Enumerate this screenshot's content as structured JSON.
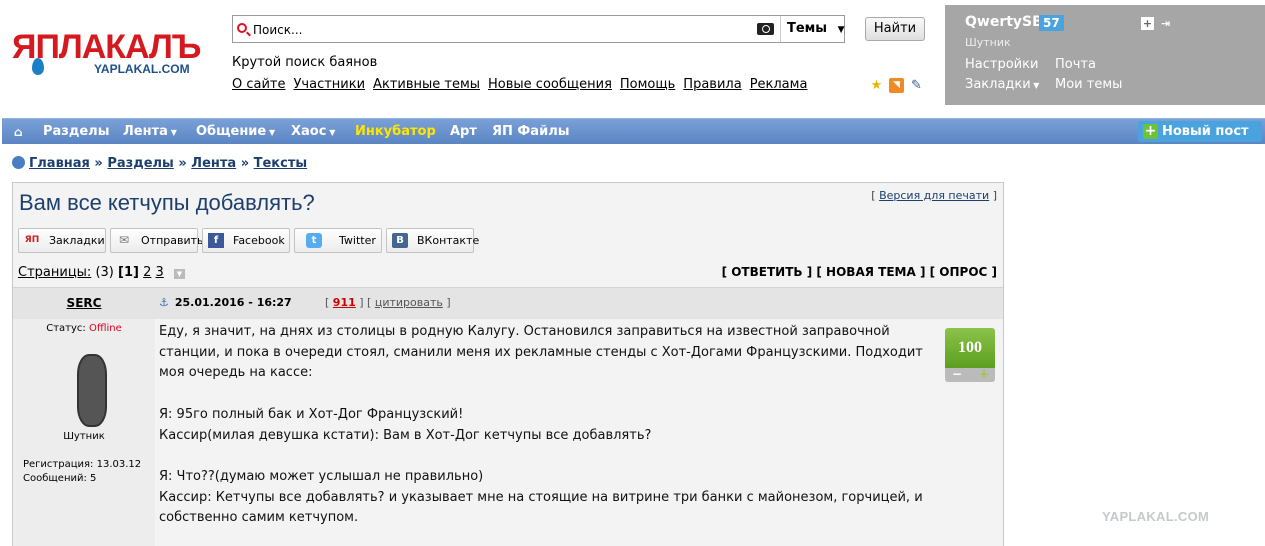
{
  "logo": {
    "main": "ЯПЛАКАЛЪ",
    "sub": "YAPLAKAL.COM"
  },
  "search": {
    "placeholder": "Поиск...",
    "scope": "Темы",
    "button": "Найти"
  },
  "tagline": "Крутой поиск баянов",
  "top_links": [
    "О сайте",
    "Участники",
    "Активные темы",
    "Новые сообщения",
    "Помощь",
    "Правила",
    "Реклама"
  ],
  "user": {
    "name": "QwertySB",
    "count": "57",
    "rank": "Шутник",
    "links": [
      "Настройки",
      "Почта",
      "Закладки",
      "Мои темы"
    ]
  },
  "nav": {
    "items": [
      "Разделы",
      "Лента",
      "Общение",
      "Хаос",
      "Инкубатор",
      "Арт",
      "ЯП Файлы"
    ],
    "new_post": "Новый пост"
  },
  "breadcrumbs": [
    "Главная",
    "Разделы",
    "Лента",
    "Тексты"
  ],
  "topic": {
    "title": "Вам все кетчупы добавлять?",
    "print_link": "Версия для печати",
    "share": [
      "Закладки",
      "Отправить",
      "Facebook",
      "Twitter",
      "ВКонтакте"
    ],
    "pages_label": "Страницы:",
    "pages_count": "(3)",
    "pages": [
      "1",
      "2",
      "3"
    ],
    "actions": [
      "ОТВЕТИТЬ",
      "НОВАЯ ТЕМА",
      "ОПРОС"
    ]
  },
  "post": {
    "author": "SERC",
    "date": "25.01.2016 - 16:27",
    "number": "911",
    "quote": "цитировать",
    "status_label": "Статус:",
    "status": "Offline",
    "rank": "Шутник",
    "registration": "Регистрация: 13.03.12",
    "messages": "Сообщений: 5",
    "rating": "100",
    "lines": [
      "Еду, я значит, на днях из столицы в родную Калугу. Остановился заправиться на известной заправочной",
      "станции, и пока в очереди стоял, сманили меня их рекламные стенды с Хот-Догами Французскими. Подходит",
      "моя очередь на кассе:",
      "",
      "Я: 95го полный бак и Хот-Дог Французский!",
      "Кассир(милая девушка кстати): Вам в Хот-Дог кетчупы все добавлять?",
      "",
      "Я: Что??(думаю может услышал не правильно)",
      "Кассир: Кетчупы все добавлять? и указывает мне на стоящие на витрине три банки с майонезом, горчицей, и",
      "собственно самим кетчупом."
    ]
  },
  "watermark": "YAPLAKAL.COM"
}
